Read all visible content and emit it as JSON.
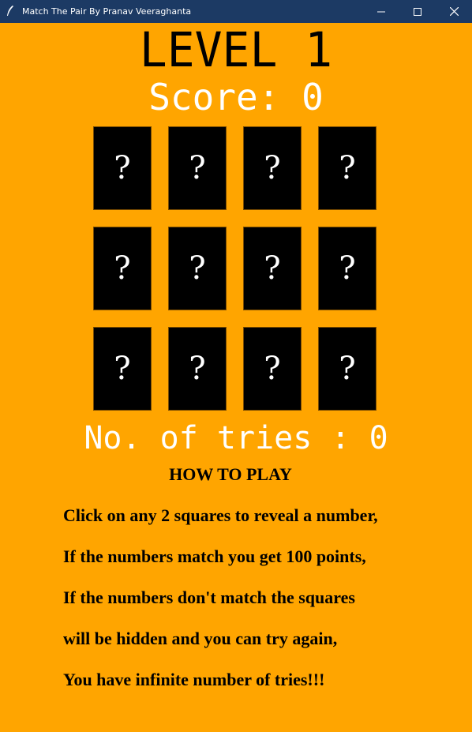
{
  "window": {
    "title": "Match The Pair By Pranav Veeraghanta",
    "titlebar_color": "#1c3a64"
  },
  "game": {
    "level": "LEVEL 1",
    "score": "Score: 0",
    "cards": [
      "?",
      "?",
      "?",
      "?",
      "?",
      "?",
      "?",
      "?",
      "?",
      "?",
      "?",
      "?"
    ],
    "tries": "No. of tries : 0",
    "background_color": "#ffa500"
  },
  "howto": {
    "heading": "HOW TO PLAY",
    "lines": [
      "Click on any 2 squares to reveal a number,",
      "If the numbers match you get 100 points,",
      "If the numbers don't match the squares",
      "will be hidden and you can try again,",
      "You have infinite number of tries!!!"
    ]
  }
}
